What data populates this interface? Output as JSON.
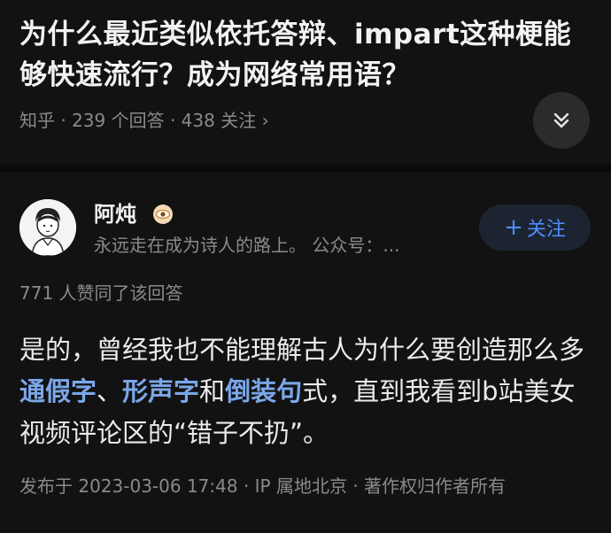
{
  "question": {
    "title": "为什么最近类似依托答辩、impart这种梗能够快速流行？成为网络常用语？",
    "meta": "知乎 · 239 个回答 · 438 关注 ›"
  },
  "author": {
    "name": "阿炖",
    "bio": "永远走在成为诗人的路上。 公众号：...",
    "follow_label": "关注",
    "follow_plus": "+"
  },
  "answer": {
    "upvotes": "771 人赞同了该回答",
    "body": {
      "p1": "是的，曾经我也不能理解古人为什么要创造那么多",
      "l1": "通假字",
      "s1": "、",
      "l2": "形声字",
      "s2": "和",
      "l3": "倒装句",
      "p2": "式，直到我看到b站美女视频评论区的“错子不扔”。"
    },
    "post_meta": "发布于 2023-03-06 17:48 · IP 属地北京 · 著作权归作者所有"
  }
}
